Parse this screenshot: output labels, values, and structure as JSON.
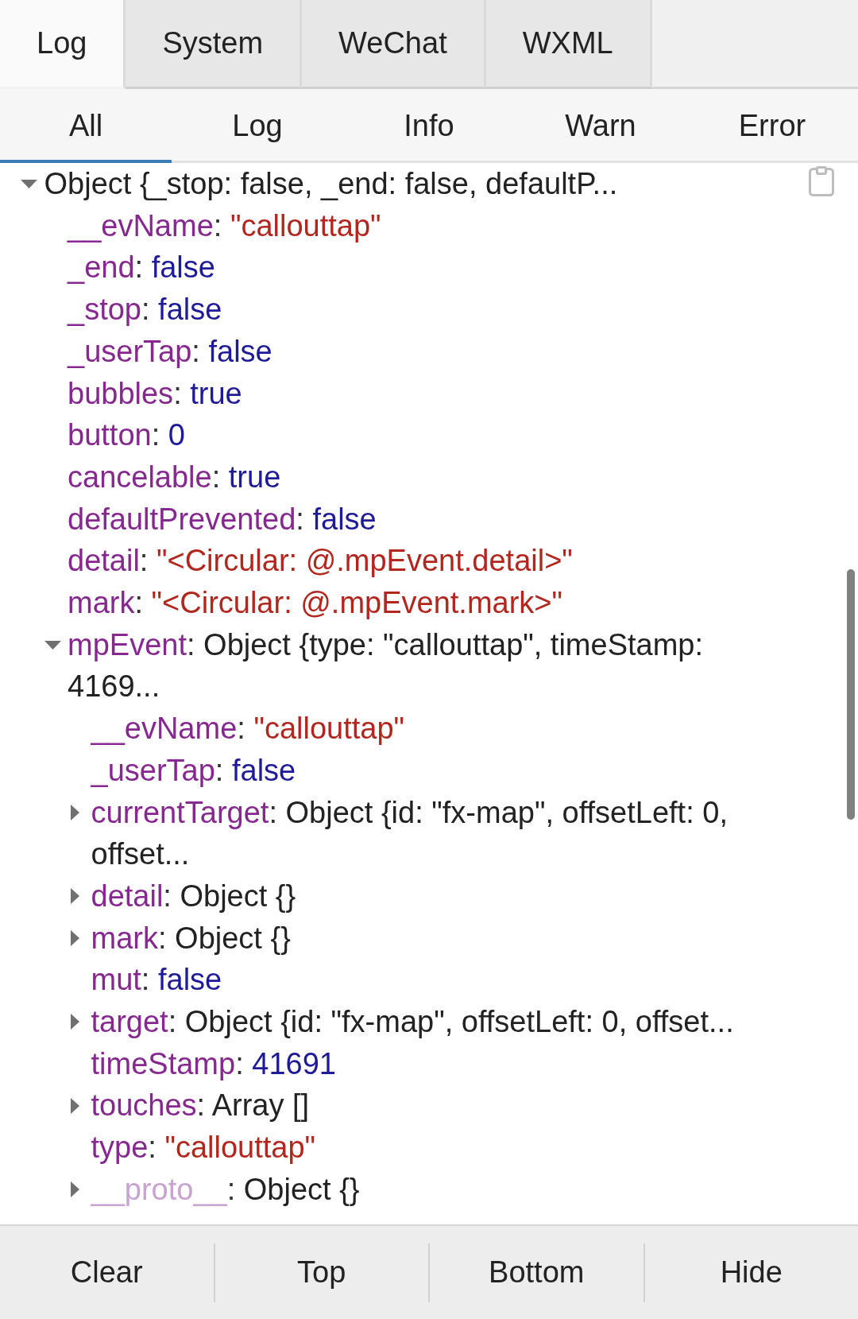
{
  "panel_tabs": [
    {
      "label": "Log",
      "selected": true
    },
    {
      "label": "System",
      "selected": false
    },
    {
      "label": "WeChat",
      "selected": false
    },
    {
      "label": "WXML",
      "selected": false
    }
  ],
  "level_filters": [
    {
      "label": "All",
      "selected": true
    },
    {
      "label": "Log",
      "selected": false
    },
    {
      "label": "Info",
      "selected": false
    },
    {
      "label": "Warn",
      "selected": false
    },
    {
      "label": "Error",
      "selected": false
    }
  ],
  "console": {
    "entries": [
      {
        "value": "Object {_stop: false, _end: false, defaultP...",
        "kind": "object",
        "expanded": true,
        "children": [
          {
            "key": "__evName",
            "separator": ":",
            "value": "\"callouttap\"",
            "kind": "string",
            "dimmed": false
          },
          {
            "key": "_end",
            "separator": ":",
            "value": "false",
            "kind": "literal",
            "dimmed": false
          },
          {
            "key": "_stop",
            "separator": ":",
            "value": "false",
            "kind": "literal",
            "dimmed": false
          },
          {
            "key": "_userTap",
            "separator": ":",
            "value": "false",
            "kind": "literal",
            "dimmed": false
          },
          {
            "key": "bubbles",
            "separator": ":",
            "value": "true",
            "kind": "literal",
            "dimmed": false
          },
          {
            "key": "button",
            "separator": ":",
            "value": "0",
            "kind": "literal",
            "dimmed": false
          },
          {
            "key": "cancelable",
            "separator": ":",
            "value": "true",
            "kind": "literal",
            "dimmed": false
          },
          {
            "key": "defaultPrevented",
            "separator": ":",
            "value": "false",
            "kind": "literal",
            "dimmed": false
          },
          {
            "key": "detail",
            "separator": ":",
            "value": "\"<Circular: @.mpEvent.detail>\"",
            "kind": "string",
            "dimmed": false
          },
          {
            "key": "mark",
            "separator": ":",
            "value": "\"<Circular: @.mpEvent.mark>\"",
            "kind": "string",
            "dimmed": false
          },
          {
            "key": "mpEvent",
            "separator": ":",
            "value": "Object {type: \"callouttap\", timeStamp: 4169...",
            "kind": "object",
            "dimmed": false,
            "expanded": true,
            "children": [
              {
                "key": "__evName",
                "separator": ":",
                "value": "\"callouttap\"",
                "kind": "string",
                "dimmed": false
              },
              {
                "key": "_userTap",
                "separator": ":",
                "value": "false",
                "kind": "literal",
                "dimmed": false
              },
              {
                "key": "currentTarget",
                "separator": ":",
                "value": "Object {id: \"fx-map\", offsetLeft: 0, offset...",
                "kind": "object",
                "dimmed": false,
                "expanded": false
              },
              {
                "key": "detail",
                "separator": ":",
                "value": "Object {}",
                "kind": "object",
                "dimmed": false,
                "expanded": false
              },
              {
                "key": "mark",
                "separator": ":",
                "value": "Object {}",
                "kind": "object",
                "dimmed": false,
                "expanded": false
              },
              {
                "key": "mut",
                "separator": ":",
                "value": "false",
                "kind": "literal",
                "dimmed": false
              },
              {
                "key": "target",
                "separator": ":",
                "value": "Object {id: \"fx-map\", offsetLeft: 0, offset...",
                "kind": "object",
                "dimmed": false,
                "expanded": false
              },
              {
                "key": "timeStamp",
                "separator": ":",
                "value": "41691",
                "kind": "literal",
                "dimmed": false
              },
              {
                "key": "touches",
                "separator": ":",
                "value": "Array []",
                "kind": "object",
                "dimmed": false,
                "expanded": false
              },
              {
                "key": "type",
                "separator": ":",
                "value": "\"callouttap\"",
                "kind": "string",
                "dimmed": false
              },
              {
                "key": "__proto__",
                "separator": ":",
                "value": "Object {}",
                "kind": "object",
                "dimmed": true,
                "expanded": false
              }
            ]
          }
        ]
      }
    ]
  },
  "toolbar": {
    "buttons": [
      "Clear",
      "Top",
      "Bottom",
      "Hide"
    ]
  }
}
